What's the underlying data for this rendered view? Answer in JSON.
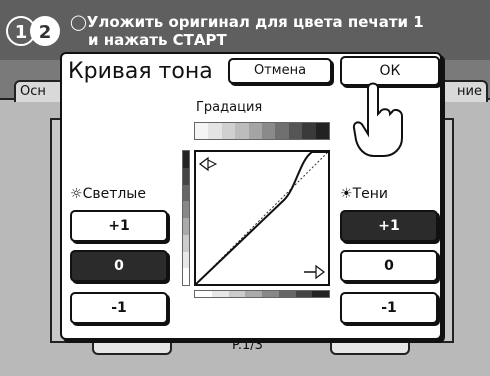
{
  "header": {
    "step1": "1",
    "step2": "2",
    "message_line1": "Уложить оригинал для цвета печати 1",
    "message_line2": "и нажать СТАРТ",
    "tab_left": "Осн",
    "tab_right": "ние"
  },
  "background": {
    "page_indicator": "P.1/3"
  },
  "dialog": {
    "title": "Кривая тона",
    "cancel_label": "Отмена",
    "ok_label": "ОК",
    "gradation_label": "Градация",
    "highlights": {
      "label": "Светлые",
      "buttons": [
        "+1",
        "0",
        "-1"
      ],
      "selected": "0"
    },
    "shadows": {
      "label": "Тени",
      "buttons": [
        "+1",
        "0",
        "-1"
      ],
      "selected": "+1"
    }
  },
  "colors": {
    "selected_button": "#2b2b2b",
    "dialog_bg": "#ffffff",
    "header_bg": "#5f5f5f"
  },
  "icons": {
    "step_indicator": "step-circles-icon",
    "highlight_sun": "sun-outline-icon",
    "shadow_sun": "sun-filled-icon",
    "pointer": "hand-pointer-icon"
  }
}
